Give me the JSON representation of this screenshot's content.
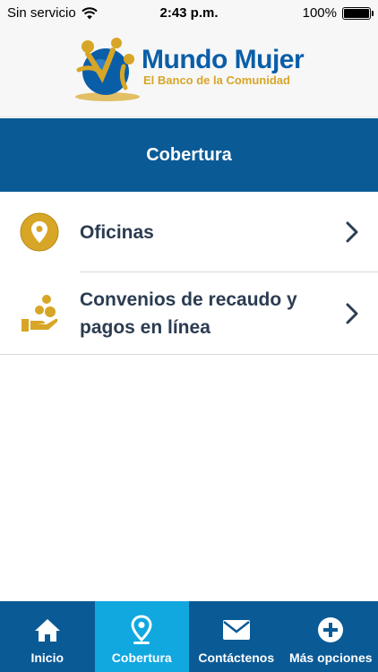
{
  "status_bar": {
    "carrier": "Sin servicio",
    "time": "2:43 p.m.",
    "battery": "100%"
  },
  "brand": {
    "name": "Mundo Mujer",
    "tagline": "El Banco de la Comunidad",
    "primary_color": "#0a5ea8",
    "gold_color": "#d8a626"
  },
  "header": {
    "title": "Cobertura"
  },
  "list": {
    "items": [
      {
        "label": "Oficinas",
        "icon": "location-pin-icon"
      },
      {
        "label": "Convenios de recaudo y pagos en línea",
        "icon": "payment-agreement-icon"
      }
    ]
  },
  "tabs": [
    {
      "label": "Inicio",
      "icon": "home-icon",
      "active": false
    },
    {
      "label": "Cobertura",
      "icon": "location-pin-icon",
      "active": true
    },
    {
      "label": "Contáctenos",
      "icon": "envelope-icon",
      "active": false
    },
    {
      "label": "Más opciones",
      "icon": "plus-circle-icon",
      "active": false
    }
  ],
  "colors": {
    "header_bar": "#0a5a96",
    "tab_active": "#11a8e0",
    "list_text": "#2b3c52"
  }
}
